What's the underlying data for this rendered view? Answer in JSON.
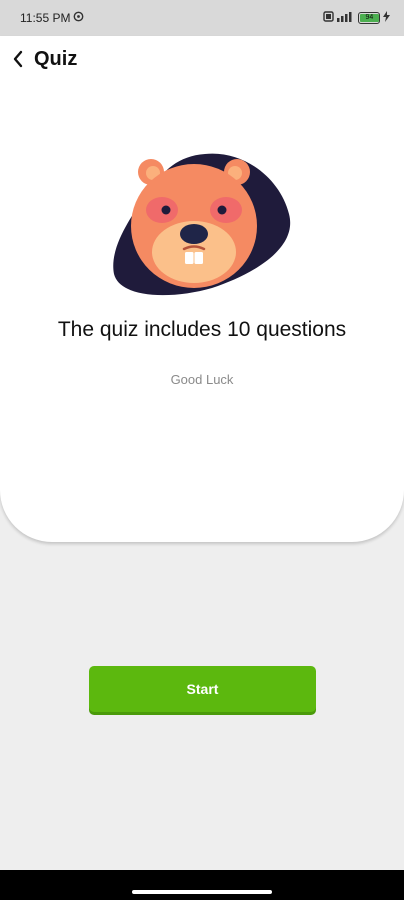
{
  "status_bar": {
    "time": "11:55 PM",
    "battery_level": "94"
  },
  "app_bar": {
    "title": "Quiz"
  },
  "content": {
    "headline": "The quiz includes 10 questions",
    "subline": "Good Luck"
  },
  "actions": {
    "start_label": "Start"
  },
  "colors": {
    "accent": "#5cb80e",
    "mascot_blob": "#1f1b3b",
    "mascot_face": "#f58a62"
  },
  "icons": {
    "back": "chevron-left-icon",
    "mascot": "beaver-mascot-icon",
    "battery": "battery-icon",
    "signal": "signal-icon"
  }
}
